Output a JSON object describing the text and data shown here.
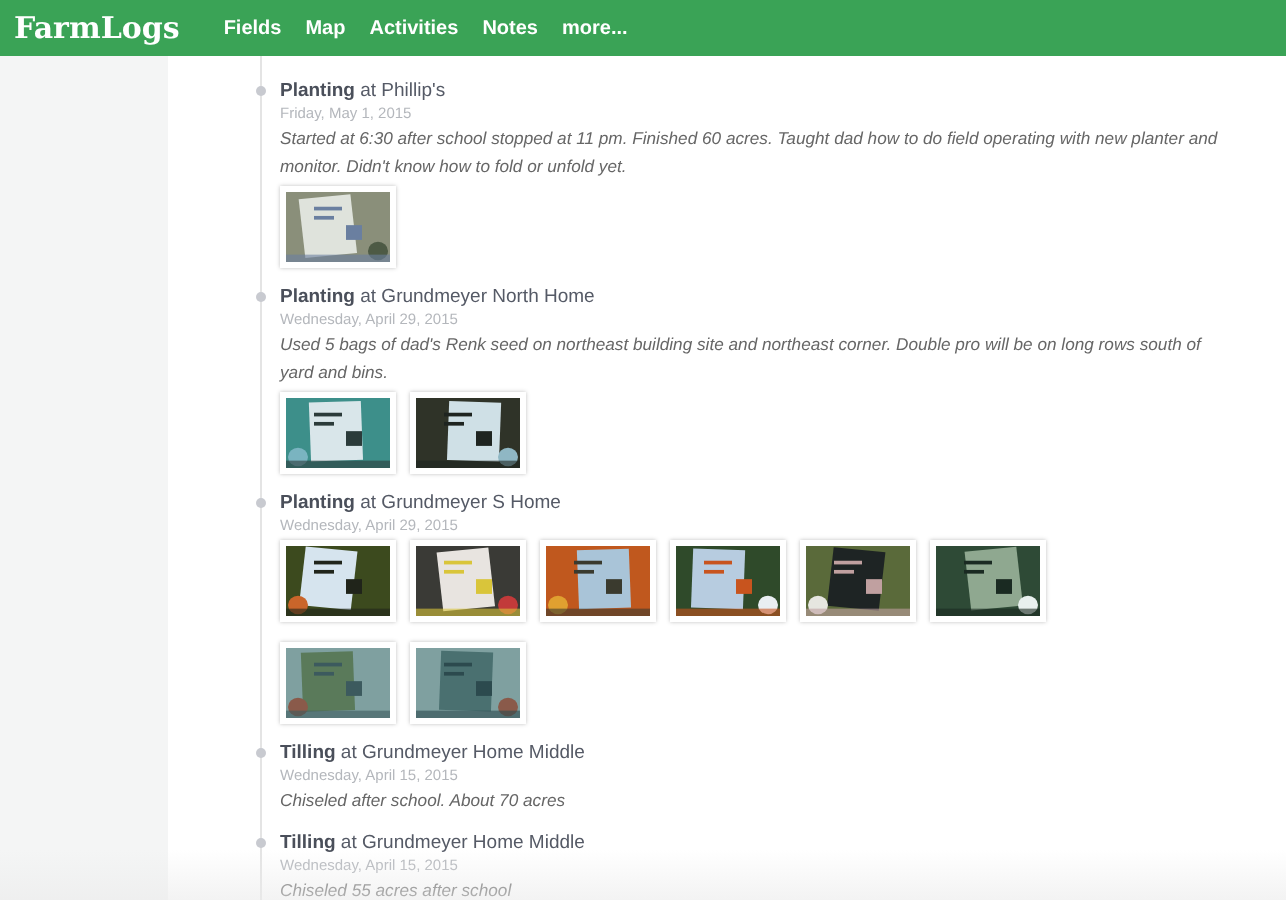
{
  "nav": {
    "logo": "FarmLogs",
    "links": [
      "Fields",
      "Map",
      "Activities",
      "Notes",
      "more..."
    ]
  },
  "activities": [
    {
      "title": "**Planting** at Phillip's",
      "date": "Friday, May 1, 2015",
      "note": "Started at 6:30 after school stopped at 11 pm. Finished 60 acres. Taught dad how to do field operating with new planter and monitor. Didn't know how to fold or unfold yet."
    },
    {
      "title": "**Planting** at Grundmeyer North Home",
      "date": "Wednesday, April 29, 2015",
      "note": "Used 5 bags of dad's Renk seed on northeast building site and northeast corner. Double pro will be on long rows south of yard and bins."
    },
    {
      "title": "**Planting** at Grundmeyer S Home",
      "date": "Wednesday, April 29, 2015"
    },
    {
      "title": "**Tilling** at Grundmeyer Home Middle",
      "date": "Wednesday, April 15, 2015",
      "note": "Chiseled after school. About 70 acres"
    },
    {
      "title": "**Tilling** at Grundmeyer Home Middle",
      "date": "Wednesday, April 15, 2015",
      "note": "Chiseled 55 acres after school"
    }
  ]
}
